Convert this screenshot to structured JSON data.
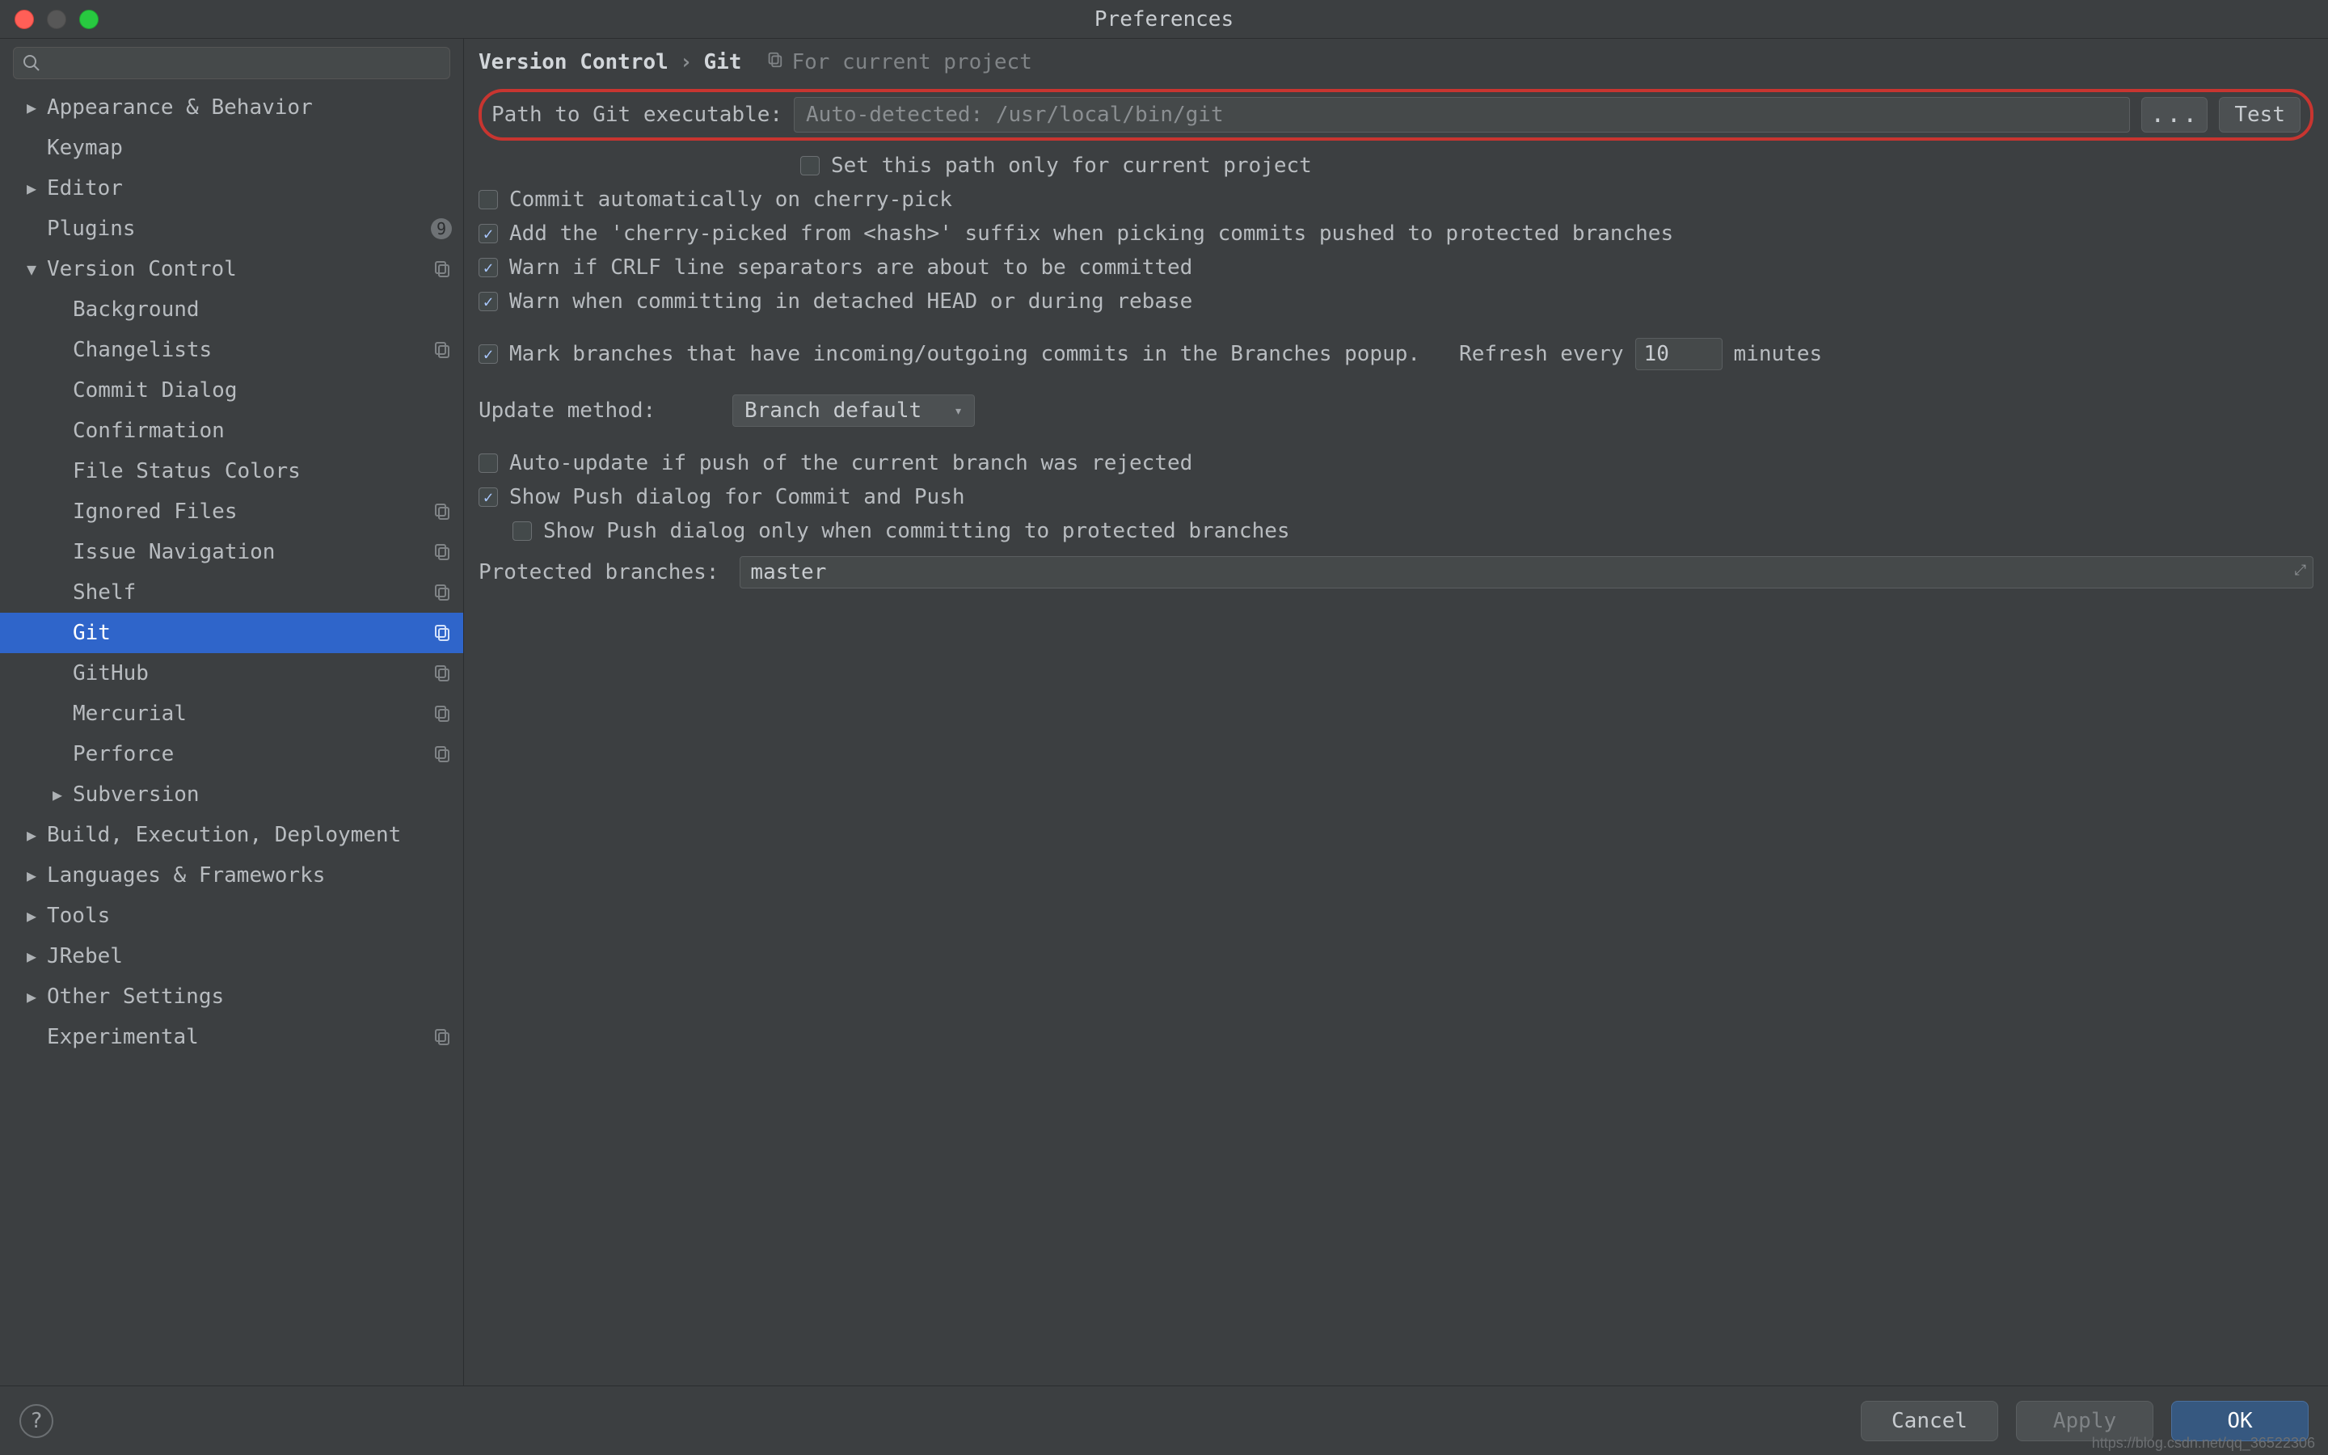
{
  "window_title": "Preferences",
  "search_placeholder": "",
  "sidebar": [
    {
      "label": "Appearance & Behavior",
      "indent": 0,
      "arrow": "right",
      "badge": null
    },
    {
      "label": "Keymap",
      "indent": 0,
      "arrow": "blank",
      "badge": null
    },
    {
      "label": "Editor",
      "indent": 0,
      "arrow": "right",
      "badge": null
    },
    {
      "label": "Plugins",
      "indent": 0,
      "arrow": "blank",
      "badge": "9"
    },
    {
      "label": "Version Control",
      "indent": 0,
      "arrow": "down",
      "badge": "copy"
    },
    {
      "label": "Background",
      "indent": 1,
      "arrow": "blank",
      "badge": null
    },
    {
      "label": "Changelists",
      "indent": 1,
      "arrow": "blank",
      "badge": "copy"
    },
    {
      "label": "Commit Dialog",
      "indent": 1,
      "arrow": "blank",
      "badge": null
    },
    {
      "label": "Confirmation",
      "indent": 1,
      "arrow": "blank",
      "badge": null
    },
    {
      "label": "File Status Colors",
      "indent": 1,
      "arrow": "blank",
      "badge": null
    },
    {
      "label": "Ignored Files",
      "indent": 1,
      "arrow": "blank",
      "badge": "copy"
    },
    {
      "label": "Issue Navigation",
      "indent": 1,
      "arrow": "blank",
      "badge": "copy"
    },
    {
      "label": "Shelf",
      "indent": 1,
      "arrow": "blank",
      "badge": "copy"
    },
    {
      "label": "Git",
      "indent": 1,
      "arrow": "blank",
      "badge": "copy",
      "selected": true
    },
    {
      "label": "GitHub",
      "indent": 1,
      "arrow": "blank",
      "badge": "copy"
    },
    {
      "label": "Mercurial",
      "indent": 1,
      "arrow": "blank",
      "badge": "copy"
    },
    {
      "label": "Perforce",
      "indent": 1,
      "arrow": "blank",
      "badge": "copy"
    },
    {
      "label": "Subversion",
      "indent": 1,
      "arrow": "right",
      "badge": null
    },
    {
      "label": "Build, Execution, Deployment",
      "indent": 0,
      "arrow": "right",
      "badge": null
    },
    {
      "label": "Languages & Frameworks",
      "indent": 0,
      "arrow": "right",
      "badge": null
    },
    {
      "label": "Tools",
      "indent": 0,
      "arrow": "right",
      "badge": null
    },
    {
      "label": "JRebel",
      "indent": 0,
      "arrow": "right",
      "badge": null
    },
    {
      "label": "Other Settings",
      "indent": 0,
      "arrow": "right",
      "badge": null
    },
    {
      "label": "Experimental",
      "indent": 0,
      "arrow": "blank",
      "badge": "copy"
    }
  ],
  "breadcrumb": {
    "parent": "Version Control",
    "sep": "›",
    "leaf": "Git"
  },
  "for_project_label": "For current project",
  "path_label": "Path to Git executable:",
  "path_placeholder": "Auto-detected: /usr/local/bin/git",
  "browse_label": "...",
  "test_label": "Test",
  "checks": {
    "set_path_project": {
      "label": "Set this path only for current project",
      "checked": false
    },
    "auto_commit_cherry": {
      "label": "Commit automatically on cherry-pick",
      "checked": false
    },
    "cherry_suffix": {
      "label": "Add the 'cherry-picked from <hash>' suffix when picking commits pushed to protected branches",
      "checked": true
    },
    "crlf_warn": {
      "label": "Warn if CRLF line separators are about to be committed",
      "checked": true
    },
    "detached_warn": {
      "label": "Warn when committing in detached HEAD or during rebase",
      "checked": true
    },
    "mark_branches": {
      "label": "Mark branches that have incoming/outgoing commits in the Branches popup.",
      "checked": true
    },
    "refresh_label": "Refresh every",
    "refresh_value": "10",
    "minutes_label": "minutes",
    "auto_update": {
      "label": "Auto-update if push of the current branch was rejected",
      "checked": false
    },
    "show_push": {
      "label": "Show Push dialog for Commit and Push",
      "checked": true
    },
    "show_push_protected": {
      "label": "Show Push dialog only when committing to protected branches",
      "checked": false
    }
  },
  "update_method_label": "Update method:",
  "update_method_value": "Branch default",
  "protected_label": "Protected branches:",
  "protected_value": "master",
  "footer": {
    "cancel": "Cancel",
    "apply": "Apply",
    "ok": "OK"
  },
  "watermark": "https://blog.csdn.net/qq_36522306"
}
